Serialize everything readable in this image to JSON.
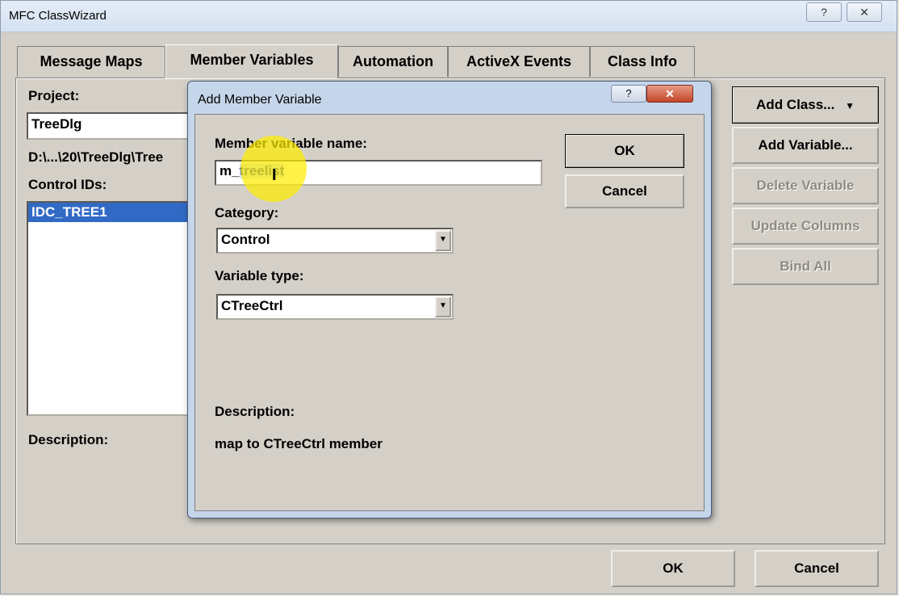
{
  "window": {
    "title": "MFC ClassWizard",
    "help_glyph": "?",
    "close_glyph": "✕"
  },
  "tabs": [
    {
      "label": "Message Maps"
    },
    {
      "label": "Member Variables"
    },
    {
      "label": "Automation"
    },
    {
      "label": "ActiveX Events"
    },
    {
      "label": "Class Info"
    }
  ],
  "left_panel": {
    "project_label": "Project:",
    "project_value": "TreeDlg",
    "path_text": "D:\\...\\20\\TreeDlg\\Tree",
    "control_ids_label": "Control IDs:",
    "control_ids": [
      "IDC_TREE1"
    ],
    "description_label": "Description:"
  },
  "right_buttons": {
    "add_class": "Add Class...",
    "add_class_arrow": "▼",
    "add_variable": "Add Variable...",
    "delete_variable": "Delete Variable",
    "update_columns": "Update Columns",
    "bind_all": "Bind All"
  },
  "bottom_buttons": {
    "ok": "OK",
    "cancel": "Cancel"
  },
  "dialog": {
    "title": "Add Member Variable",
    "help_glyph": "?",
    "close_glyph": "✕",
    "name_label": "Member variable name:",
    "name_prefix": "m_",
    "name_selected": "tree",
    "name_suffix": "list",
    "category_label": "Category:",
    "category_value": "Control",
    "type_label": "Variable type:",
    "type_value": "CTreeCtrl",
    "description_label": "Description:",
    "description_text": "map to CTreeCtrl member",
    "ok": "OK",
    "cancel": "Cancel",
    "combo_arrow": "▼"
  }
}
